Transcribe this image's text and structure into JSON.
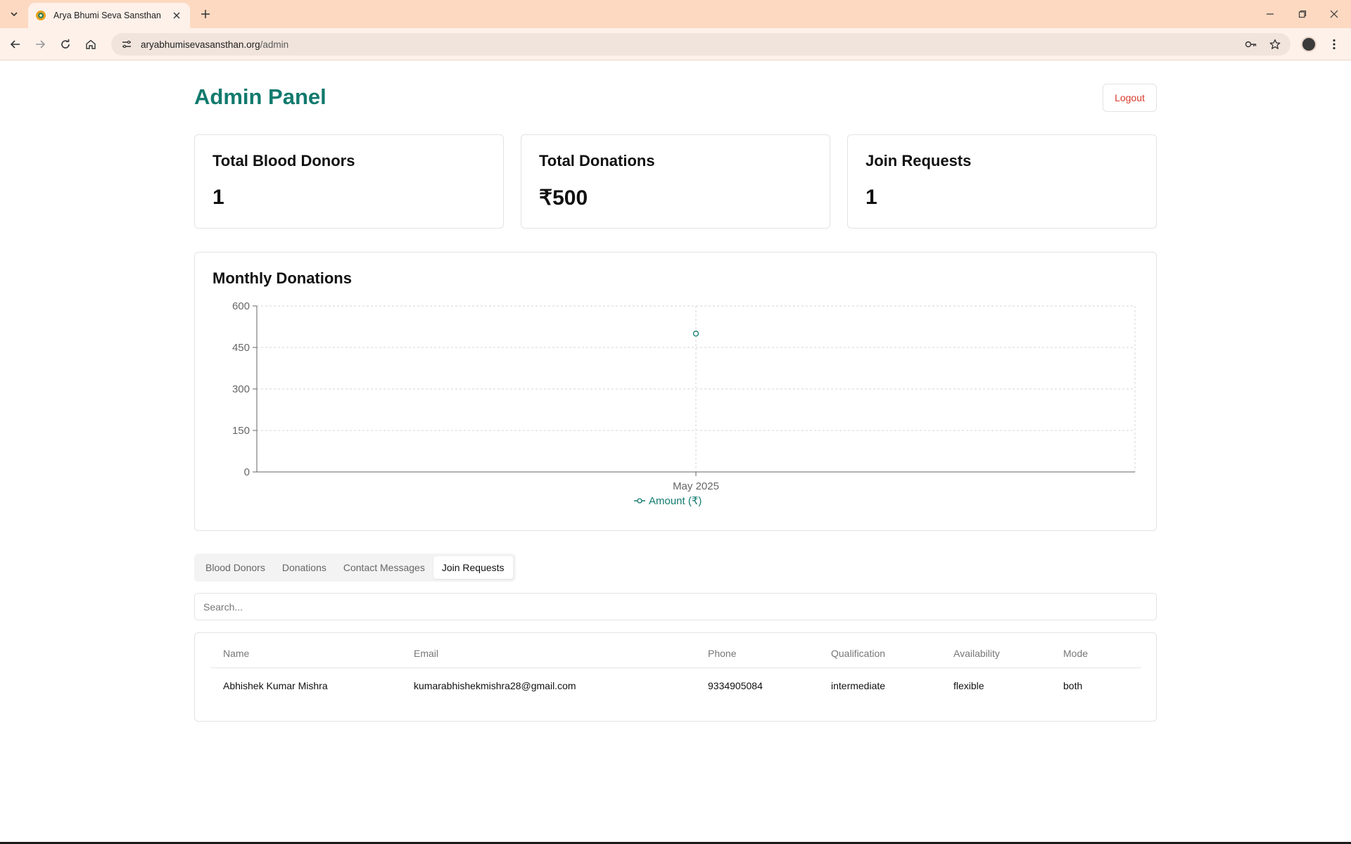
{
  "browser": {
    "tab_title": "Arya Bhumi Seva Sansthan",
    "url_domain": "aryabhumisevasansthan.org",
    "url_path": "/admin",
    "icons": [
      "tab-list-icon",
      "favicon-icon",
      "close-icon",
      "plus-icon",
      "minimize-icon",
      "restore-icon",
      "close-window-icon",
      "back-icon",
      "forward-icon",
      "reload-icon",
      "home-icon",
      "site-info-icon",
      "password-key-icon",
      "star-icon",
      "avatar",
      "more-icon"
    ]
  },
  "page": {
    "title": "Admin Panel",
    "logout_label": "Logout",
    "accent_color": "#127a6e",
    "danger_color": "#d93a2b"
  },
  "stats": [
    {
      "label": "Total Blood Donors",
      "value": "1"
    },
    {
      "label": "Total Donations",
      "value": "₹500"
    },
    {
      "label": "Join Requests",
      "value": "1"
    }
  ],
  "chart": {
    "title": "Monthly Donations"
  },
  "chart_data": {
    "type": "line",
    "categories": [
      "May 2025"
    ],
    "series": [
      {
        "name": "Amount (₹)",
        "values": [
          500
        ],
        "color": "#127a6e"
      }
    ],
    "ylim": [
      0,
      600
    ],
    "yticks": [
      0,
      150,
      300,
      450,
      600
    ],
    "grid": true,
    "legend": "bottom"
  },
  "tabs": [
    {
      "label": "Blood Donors",
      "active": false
    },
    {
      "label": "Donations",
      "active": false
    },
    {
      "label": "Contact Messages",
      "active": false
    },
    {
      "label": "Join Requests",
      "active": true
    }
  ],
  "search": {
    "placeholder": "Search...",
    "value": ""
  },
  "table": {
    "columns": [
      "Name",
      "Email",
      "Phone",
      "Qualification",
      "Availability",
      "Mode"
    ],
    "rows": [
      [
        "Abhishek Kumar Mishra",
        "kumarabhishekmishra28@gmail.com",
        "9334905084",
        "intermediate",
        "flexible",
        "both"
      ]
    ]
  }
}
